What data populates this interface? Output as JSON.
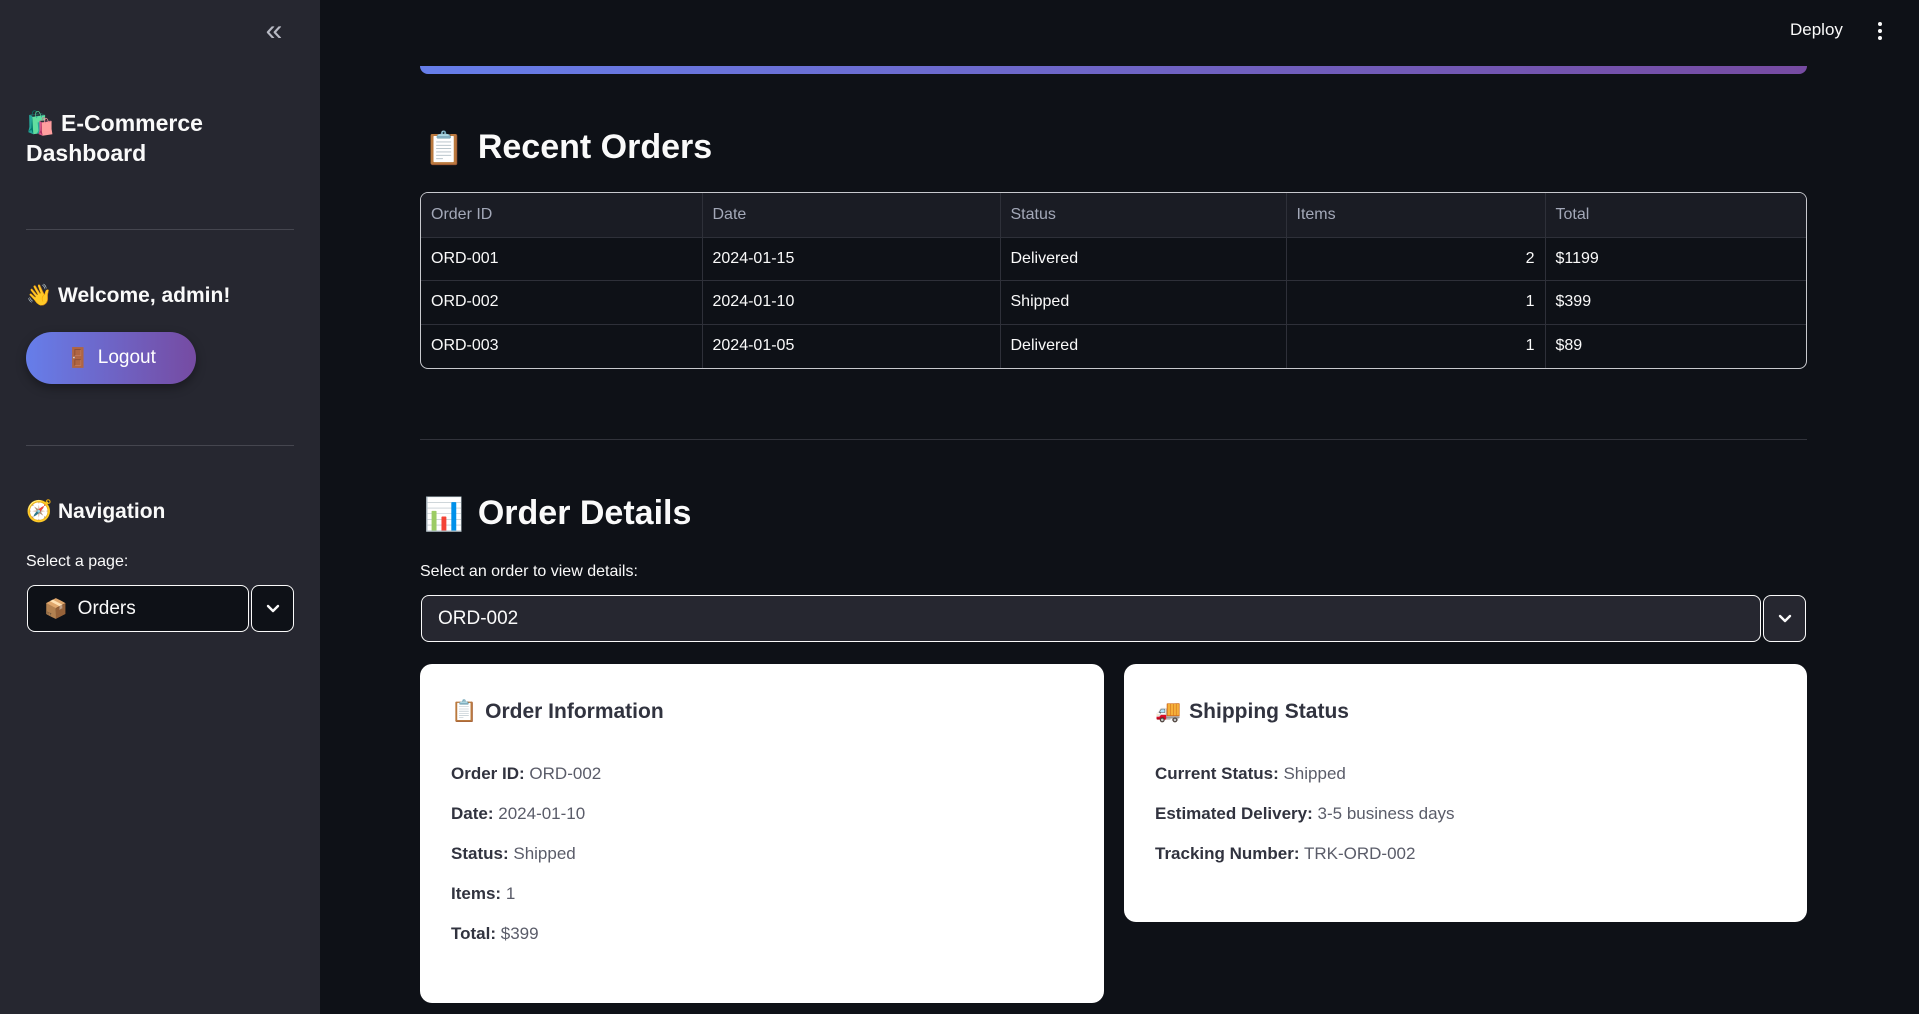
{
  "sidebar": {
    "collapse_icon": "«",
    "brand_emoji": "🛍️",
    "brand_title": "E-Commerce Dashboard",
    "welcome_emoji": "👋",
    "welcome_text": "Welcome, admin!",
    "logout_emoji": "🚪",
    "logout_label": "Logout",
    "nav_emoji": "🧭",
    "nav_title": "Navigation",
    "select_label": "Select a page:",
    "selected_page_emoji": "📦",
    "selected_page": "Orders"
  },
  "header": {
    "deploy_label": "Deploy",
    "menu_icon": "kebab-menu-icon"
  },
  "recent_orders": {
    "emoji": "📋",
    "title": "Recent Orders",
    "columns": [
      "Order ID",
      "Date",
      "Status",
      "Items",
      "Total"
    ],
    "rows": [
      [
        "ORD-001",
        "2024-01-15",
        "Delivered",
        "2",
        "$1199"
      ],
      [
        "ORD-002",
        "2024-01-10",
        "Shipped",
        "1",
        "$399"
      ],
      [
        "ORD-003",
        "2024-01-05",
        "Delivered",
        "1",
        "$89"
      ]
    ]
  },
  "order_details": {
    "emoji": "📊",
    "title": "Order Details",
    "select_label": "Select an order to view details:",
    "selected_order": "ORD-002",
    "info_card": {
      "emoji": "📋",
      "title": "Order Information",
      "fields": [
        {
          "label": "Order ID:",
          "value": "ORD-002"
        },
        {
          "label": "Date:",
          "value": "2024-01-10"
        },
        {
          "label": "Status:",
          "value": "Shipped"
        },
        {
          "label": "Items:",
          "value": "1"
        },
        {
          "label": "Total:",
          "value": "$399"
        }
      ]
    },
    "shipping_card": {
      "emoji": "🚚",
      "title": "Shipping Status",
      "fields": [
        {
          "label": "Current Status:",
          "value": "Shipped"
        },
        {
          "label": "Estimated Delivery:",
          "value": "3-5 business days"
        },
        {
          "label": "Tracking Number:",
          "value": "TRK-ORD-002"
        }
      ]
    }
  },
  "colors": {
    "background": "#0e1117",
    "sidebar": "#262730",
    "accent_start": "#667eea",
    "accent_end": "#764ba2"
  }
}
